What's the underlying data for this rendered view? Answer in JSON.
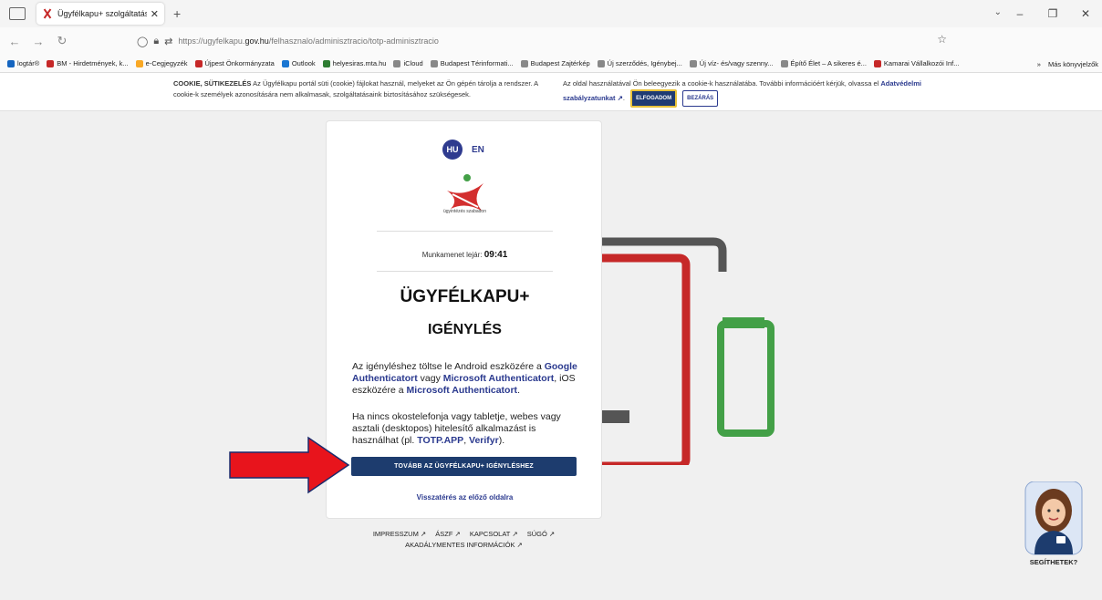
{
  "browser": {
    "tab_title": "Ügyfélkapu+ szolgáltatás igény",
    "tab_close": "✕",
    "new_tab": "+",
    "url_prefix": "https://ugyfelkapu.",
    "url_domain": "gov.hu",
    "url_path": "/felhasznalo/adminisztracio/totp-adminisztracio",
    "bookmarks": [
      {
        "label": "logtár®",
        "color": "#1565c0"
      },
      {
        "label": "BM - Hirdetmények, k...",
        "color": "#c62828"
      },
      {
        "label": "e-Cegjegyzék",
        "color": "#f9a825"
      },
      {
        "label": "Újpest Önkormányzata",
        "color": "#c62828"
      },
      {
        "label": "Outlook",
        "color": "#1976d2"
      },
      {
        "label": "helyesiras.mta.hu",
        "color": "#2e7d32"
      },
      {
        "label": "iCloud",
        "color": "#888888"
      },
      {
        "label": "Budapest Térinformati...",
        "color": "#888888"
      },
      {
        "label": "Budapest Zajtérkép",
        "color": "#888888"
      },
      {
        "label": "Új szerződés, Igénybej...",
        "color": "#888888"
      },
      {
        "label": "Új víz- és/vagy szenny...",
        "color": "#888888"
      },
      {
        "label": "Építő Élet – A sikeres é...",
        "color": "#888888"
      },
      {
        "label": "Kamarai Vállalkozói Inf...",
        "color": "#c62828"
      }
    ],
    "bookmarks_more": "»",
    "other_bookmarks": "Más könyvjelzők"
  },
  "cookie": {
    "heading": "COOKIE, SÜTIKEZELÉS",
    "text1": " Az Ügyfélkapu portál süti (cookie) fájlokat használ, melyeket az Ön gépén tárolja a rendszer. A cookie-k személyek azonosítására nem alkalmasak, szolgáltatásaink biztosításához szükségesek.",
    "text2": "Az oldal használatával Ön beleegyezik a cookie-k használatába. További információért kérjük, olvassa el ",
    "link": "Adatvédelmi szabályzatunkat ↗",
    "after_link": ".",
    "accept": "ELFOGADOM",
    "close": "BEZÁRÁS"
  },
  "card": {
    "lang_hu": "HU",
    "lang_en": "EN",
    "logo_text": "ügyintézés szabadon",
    "session_label": "Munkamenet lejár: ",
    "session_time": "09:41",
    "title1": "ÜGYFÉLKAPU+",
    "title2": "IGÉNYLÉS",
    "p1_a": "Az igényléshez töltse le Android eszközére a ",
    "p1_link1": "Google Authenticatort",
    "p1_b": " vagy ",
    "p1_link2": "Microsoft Authenticatort",
    "p1_c": ", iOS eszközére a ",
    "p1_link3": "Microsoft Authenticatort",
    "p1_d": ".",
    "p2_a": "Ha nincs okostelefonja vagy tabletje, webes vagy asztali (desktopos) hitelesítő alkalmazást is használhat (pl. ",
    "p2_link1": "TOTP.APP",
    "p2_b": ", ",
    "p2_link2": "Verifyr",
    "p2_c": ").",
    "main_button": "TOVÁBB AZ ÜGYFÉLKAPU+ IGÉNYLÉSHEZ",
    "back_link": "Visszatérés az előző oldalra"
  },
  "footer": {
    "impresszum": "IMPRESSZUM ↗",
    "aszf": "ÁSZF ↗",
    "kapcsolat": "KAPCSOLAT ↗",
    "sugo": "SÚGÓ ↗",
    "akadalymentes": "AKADÁLYMENTES INFORMÁCIÓK ↗"
  },
  "helper": {
    "label": "SEGÍTHETEK?"
  },
  "colors": {
    "primary": "#1d3c6e",
    "link": "#2b3a8f",
    "arrow": "#e8141c"
  }
}
